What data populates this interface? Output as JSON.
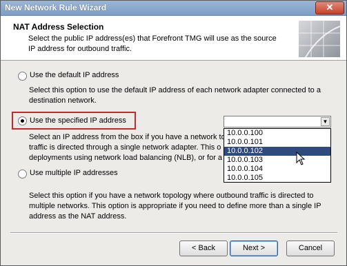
{
  "window": {
    "title": "New Network Rule Wizard",
    "close_glyph": "✕"
  },
  "header": {
    "title": "NAT Address Selection",
    "description": "Select the public IP address(es) that Forefront TMG will use as the source IP address for outbound traffic."
  },
  "options": {
    "default": {
      "label": "Use the default IP address",
      "description": "Select this option to use the default IP address of each network adapter connected to a destination network.",
      "selected": false
    },
    "specified": {
      "label": "Use the specified IP address",
      "description_lines": [
        "Select an IP address from the box if you have a network to",
        "traffic is directed through a single network adapter. This o",
        "deployments using network load balancing (NLB), or for a s"
      ],
      "selected": true
    },
    "multiple": {
      "label": "Use multiple IP addresses",
      "description": "Select this option if you have a network topology where outbound traffic is directed to multiple networks. This option is appropriate if you need to define more than a single IP address as the NAT address.",
      "selected": false
    }
  },
  "ip_dropdown": {
    "value": "",
    "arrow_glyph": "▼",
    "items": [
      "10.0.0.100",
      "10.0.0.101",
      "10.0.0.102",
      "10.0.0.103",
      "10.0.0.104",
      "10.0.0.105"
    ],
    "highlighted_index": 2
  },
  "buttons": {
    "back": "< Back",
    "next": "Next >",
    "cancel": "Cancel"
  }
}
